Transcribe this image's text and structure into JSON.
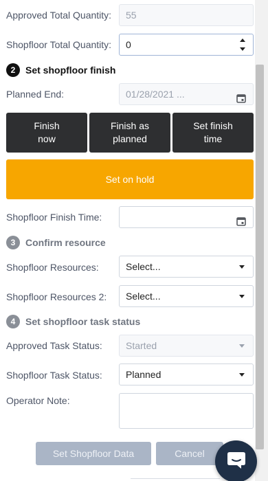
{
  "fields": {
    "approved_total_quantity": {
      "label": "Approved Total Quantity:",
      "value": "55"
    },
    "shopfloor_total_quantity": {
      "label": "Shopfloor Total Quantity:",
      "value": "0"
    }
  },
  "steps": {
    "step2": {
      "number": "2",
      "title": "Set shopfloor finish"
    },
    "step3": {
      "number": "3",
      "title": "Confirm resource"
    },
    "step4": {
      "number": "4",
      "title": "Set shopfloor task status"
    }
  },
  "planned_end": {
    "label": "Planned End:",
    "value": "01/28/2021 ..."
  },
  "finish_buttons": {
    "finish_now": "Finish\nnow",
    "finish_as_planned": "Finish as\nplanned",
    "set_finish_time": "Set finish\ntime"
  },
  "hold_button": "Set on hold",
  "shopfloor_finish_time": {
    "label": "Shopfloor Finish Time:",
    "value": ""
  },
  "resources": {
    "res1": {
      "label": "Shopfloor Resources:",
      "selected": "Select..."
    },
    "res2": {
      "label": "Shopfloor Resources 2:",
      "selected": "Select..."
    }
  },
  "task_status": {
    "approved": {
      "label": "Approved Task Status:",
      "selected": "Started"
    },
    "shopfloor": {
      "label": "Shopfloor Task Status:",
      "selected": "Planned"
    }
  },
  "operator_note": {
    "label": "Operator Note:",
    "value": ""
  },
  "footer": {
    "set_data_label": "Set Shopfloor Data",
    "cancel_label": "Cancel"
  },
  "colors": {
    "accent_orange": "#f7a600",
    "dark_button": "#2e2f31",
    "disabled_button": "#aab5c6",
    "chat_bubble": "#1f3047"
  },
  "icons": {
    "calendar": "calendar-icon",
    "chat": "chat-icon",
    "spinner": "spinner-arrows-icon"
  }
}
